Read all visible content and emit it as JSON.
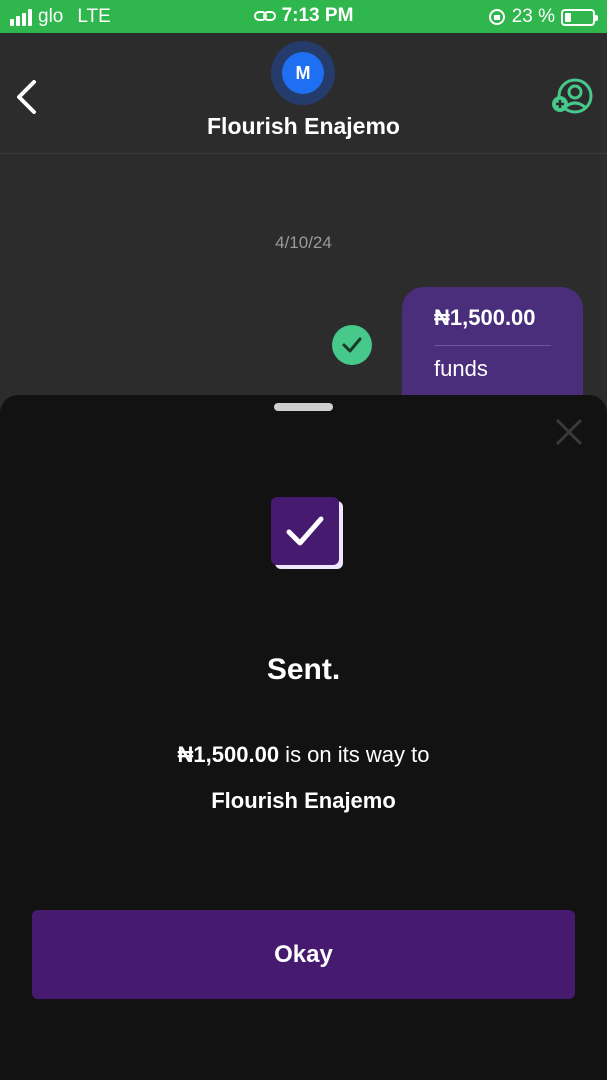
{
  "status_bar": {
    "carrier": "glo",
    "network": "LTE",
    "time": "7:13 PM",
    "battery_percent": "23 %",
    "battery_level": 0.23
  },
  "header": {
    "avatar_initial": "M",
    "contact_name": "Flourish Enajemo",
    "back_icon": "chevron-left-icon",
    "add_contact_icon": "add-user-icon"
  },
  "chat": {
    "date": "4/10/24",
    "bubble_amount": "₦1,500.00",
    "bubble_note": "funds"
  },
  "sheet": {
    "title": "Sent.",
    "amount": "₦1,500.00",
    "message_suffix": " is on its way to",
    "recipient": "Flourish Enajemo",
    "okay_label": "Okay"
  },
  "colors": {
    "status_bar": "#2fb64d",
    "accent_purple": "#461a6e",
    "bubble_purple": "#4a2e7c",
    "check_green": "#46c98a",
    "avatar_blue": "#1f6ff2"
  }
}
